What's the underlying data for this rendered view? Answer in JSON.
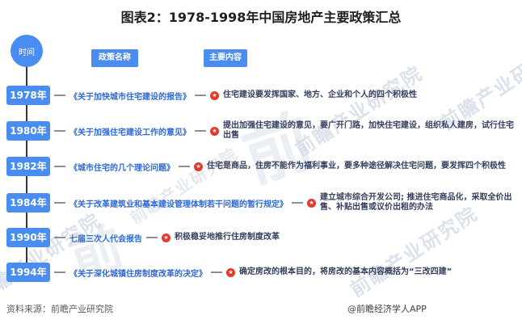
{
  "title": "图表2：1978-1998年中国房地产主要政策汇总",
  "legend": {
    "time_label": "时间",
    "policy_header": "政策名称",
    "content_header": "主要内容"
  },
  "colors": {
    "primary_blue": "#4a8df0",
    "policy_text_blue": "#3069d2",
    "content_text_navy": "#333f5c",
    "marker_red": "#e53a2b",
    "timeline_dark": "#383838"
  },
  "marker_icon": "red-star-badge",
  "timeline": [
    {
      "year": "1978年",
      "policy": "《关于加快城市住宅建设的报告》",
      "content": "住宅建设要发挥国家、地方、企业和个人的四个积极性"
    },
    {
      "year": "1980年",
      "policy": "《关于加强住宅建设工作的意见》",
      "content": "提出加强住宅建设的意见，要广开门路，加快住宅建设，组织私人建房，试行住宅出售"
    },
    {
      "year": "1982年",
      "policy": "《城市住宅的几个理论问题》",
      "content": "住宅是商品，住房不能作为福利事业，要多种途径解决住宅问题，要发挥四个积极性"
    },
    {
      "year": "1984年",
      "policy": "《关于改革建筑业和基本建设管理体制若干问题的暂行规定》",
      "content": "建立城市综合开发公司; 推进住宅商品化，采取全价出售、补贴出售或议价出租的办法"
    },
    {
      "year": "1990年",
      "policy": "七届三次人代会报告",
      "content": "积极稳妥地推行住房制度改革"
    },
    {
      "year": "1994年",
      "policy": "《关于深化城镇住房制度改革的决定》",
      "content": "确定房改的根本目的，将房改的基本内容概括为“三改四建”"
    }
  ],
  "footer": {
    "source": "资料来源：前瞻产业研究院",
    "credit": "@前瞻经济学人APP"
  },
  "watermark": {
    "text": "前瞻产业研究院",
    "logo_glyph": "前"
  },
  "marker_star": "★"
}
